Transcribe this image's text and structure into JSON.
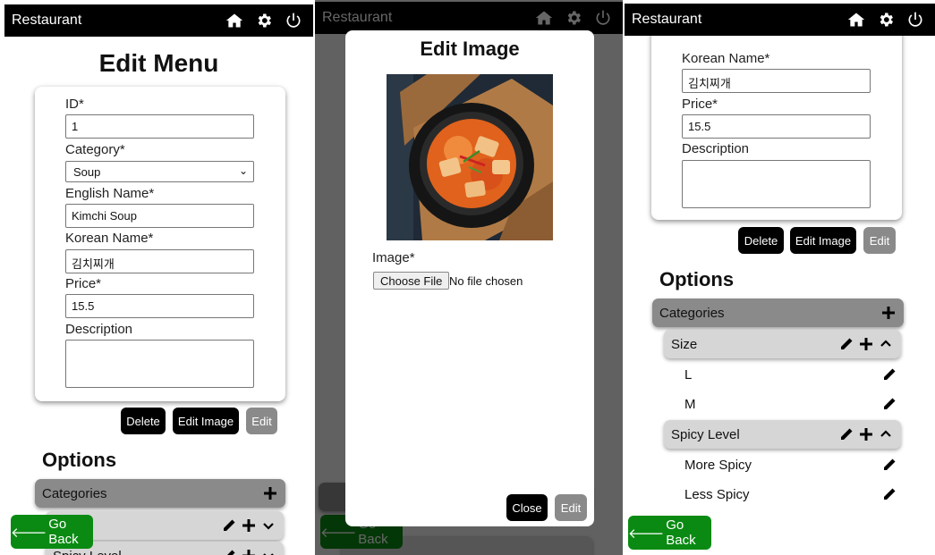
{
  "app": {
    "title": "Restaurant"
  },
  "edit_menu": {
    "title": "Edit Menu",
    "fields": {
      "id_label": "ID*",
      "id_value": "1",
      "category_label": "Category*",
      "category_value": "Soup",
      "english_label": "English Name*",
      "english_value": "Kimchi Soup",
      "korean_label": "Korean Name*",
      "korean_value": "김치찌개",
      "price_label": "Price*",
      "price_value": "15.5",
      "description_label": "Description",
      "description_value": ""
    },
    "buttons": {
      "delete": "Delete",
      "edit_image": "Edit Image",
      "edit": "Edit"
    }
  },
  "options": {
    "title": "Options",
    "categories_label": "Categories",
    "groups": [
      {
        "name": "Size",
        "items": [
          "L",
          "M"
        ]
      },
      {
        "name": "Spicy Level",
        "items": [
          "More Spicy",
          "Less Spicy"
        ]
      }
    ]
  },
  "nav": {
    "go_back": "Go Back"
  },
  "edit_image_modal": {
    "title": "Edit Image",
    "image_label": "Image*",
    "choose_file": "Choose File",
    "no_file": "No file chosen",
    "close": "Close",
    "edit": "Edit"
  },
  "colors": {
    "topbar": "#000000",
    "go_back": "#0a8a12",
    "disabled": "#8a8a8a",
    "category_bar": "#8a8a8a",
    "group_bar": "#d6d6d6"
  }
}
